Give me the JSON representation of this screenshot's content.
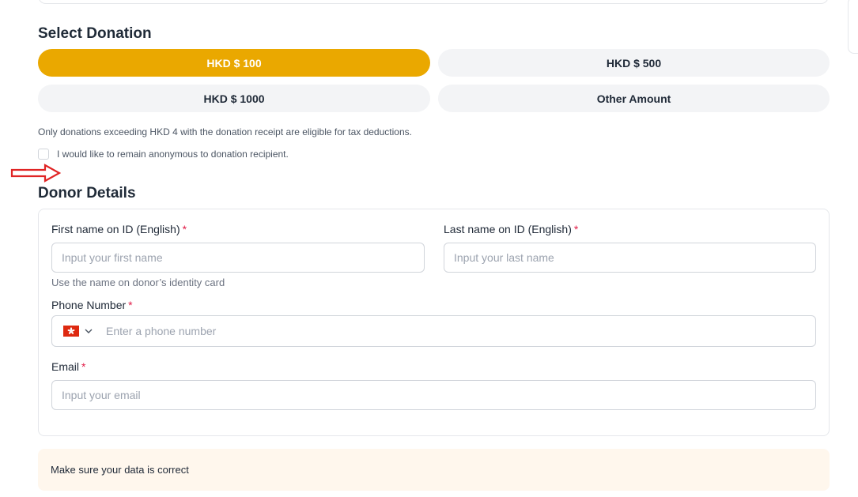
{
  "donation": {
    "title": "Select Donation",
    "options": [
      {
        "label": "HKD $ 100",
        "selected": true
      },
      {
        "label": "HKD $ 500",
        "selected": false
      },
      {
        "label": "HKD $ 1000",
        "selected": false
      },
      {
        "label": "Other Amount",
        "selected": false
      }
    ],
    "tax_note": "Only donations exceeding HKD 4 with the donation receipt are eligible for tax deductions.",
    "anonymous_label": "I would like to remain anonymous to donation recipient.",
    "anonymous_checked": false
  },
  "donor": {
    "title": "Donor Details",
    "first_name": {
      "label": "First name on ID (English)",
      "required_mark": "*",
      "placeholder": "Input your first name",
      "value": "",
      "helper": "Use the name on donor’s identity card"
    },
    "last_name": {
      "label": "Last name on ID (English)",
      "required_mark": "*",
      "placeholder": "Input your last name",
      "value": ""
    },
    "phone": {
      "label": "Phone Number",
      "required_mark": "*",
      "country_icon": "hong-kong-flag-icon",
      "placeholder": "Enter a phone number",
      "value": ""
    },
    "email": {
      "label": "Email",
      "required_mark": "*",
      "placeholder": "Input your email",
      "value": ""
    }
  },
  "notice": {
    "text": "Make sure your data is correct"
  },
  "colors": {
    "accent": "#eaa800",
    "button_bg": "#f3f4f6",
    "required": "#e11d48",
    "notice_bg": "#fff7ed",
    "arrow": "#e02424"
  }
}
